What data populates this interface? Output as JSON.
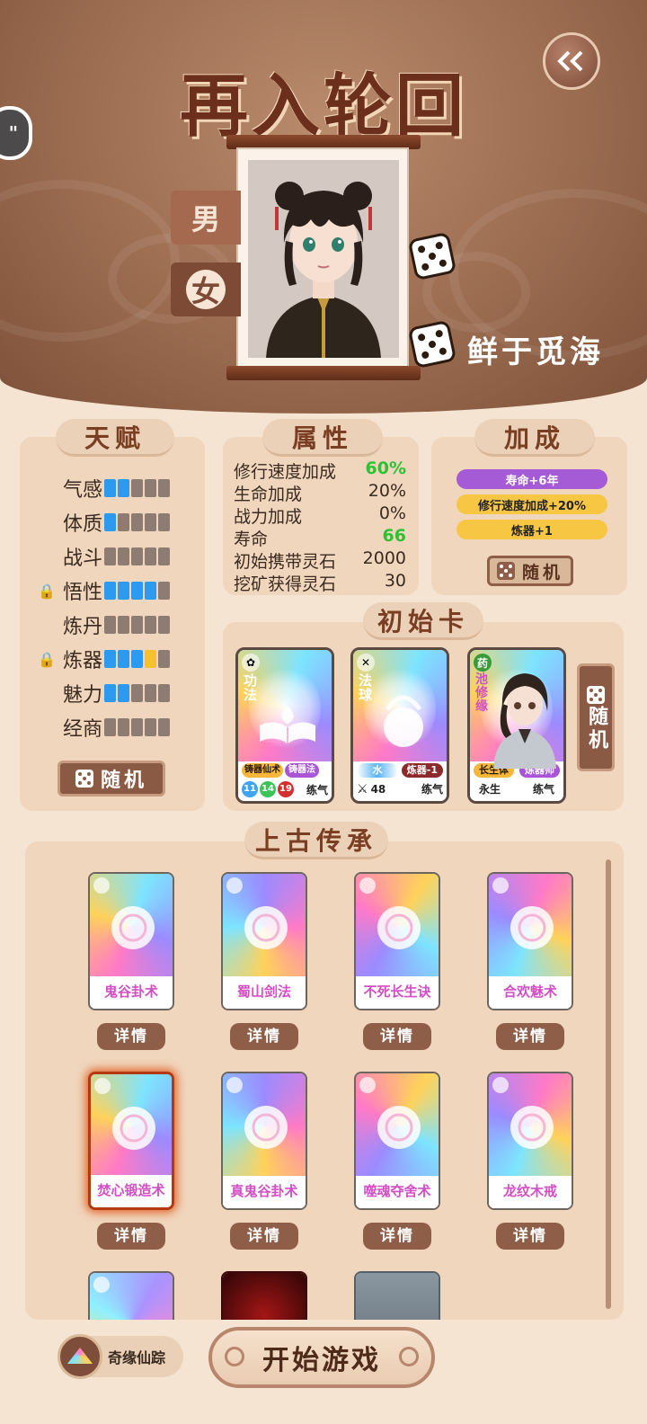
{
  "header": {
    "title": "再入轮回",
    "back_icon": "double-chevron-left-icon",
    "side_tab": "\"",
    "genders": {
      "male": "男",
      "female": "女"
    },
    "player_name": "鲜于觅海"
  },
  "talent": {
    "title": "天赋",
    "rows": [
      {
        "name": "气感",
        "locked": false,
        "blue": 2,
        "yellow": 0
      },
      {
        "name": "体质",
        "locked": false,
        "blue": 1,
        "yellow": 0
      },
      {
        "name": "战斗",
        "locked": false,
        "blue": 0,
        "yellow": 0
      },
      {
        "name": "悟性",
        "locked": true,
        "blue": 4,
        "yellow": 0
      },
      {
        "name": "炼丹",
        "locked": false,
        "blue": 0,
        "yellow": 0
      },
      {
        "name": "炼器",
        "locked": true,
        "blue": 3,
        "yellow": 1
      },
      {
        "name": "魅力",
        "locked": false,
        "blue": 2,
        "yellow": 0
      },
      {
        "name": "经商",
        "locked": false,
        "blue": 0,
        "yellow": 0
      }
    ],
    "random_label": "随机"
  },
  "attributes": {
    "title": "属性",
    "rows": [
      {
        "name": "修行速度加成",
        "value": "60%",
        "green": true
      },
      {
        "name": "生命加成",
        "value": "20%",
        "green": false
      },
      {
        "name": "战力加成",
        "value": "0%",
        "green": false
      },
      {
        "name": "寿命",
        "value": "66",
        "green": true
      },
      {
        "name": "初始携带灵石",
        "value": "2000",
        "green": false
      },
      {
        "name": "挖矿获得灵石",
        "value": "30",
        "green": false
      }
    ]
  },
  "bonus": {
    "title": "加成",
    "items": [
      {
        "text": "寿命+6年",
        "color": "#a55ad6"
      },
      {
        "text": "修行速度加成+20%",
        "color": "#f7c744"
      },
      {
        "text": "炼器+1",
        "color": "#f7c744"
      }
    ],
    "random_label": "随机"
  },
  "initial_cards": {
    "title": "初始卡",
    "random_label": "随机",
    "cards": [
      {
        "category": "功法",
        "tags": [
          "铸器仙术",
          "铸器法"
        ],
        "nums": [
          "11",
          "14",
          "19"
        ],
        "realm": "练气"
      },
      {
        "category": "法球",
        "tags": [
          "水",
          "炼器-1"
        ],
        "power": "48",
        "realm": "练气"
      },
      {
        "name": "池修缘",
        "badge": "药",
        "tags": [
          "长生体",
          "炼器师"
        ],
        "sub": "永生",
        "realm": "练气"
      }
    ]
  },
  "legacy": {
    "title": "上古传承",
    "detail_label": "详情",
    "items": [
      {
        "name": "鬼谷卦术"
      },
      {
        "name": "蜀山剑法"
      },
      {
        "name": "不死长生诀"
      },
      {
        "name": "合欢魅术"
      },
      {
        "name": "焚心锻造术",
        "selected": true
      },
      {
        "name": "真鬼谷卦术"
      },
      {
        "name": "噬魂夺舍术"
      },
      {
        "name": "龙纹木戒"
      }
    ]
  },
  "footer": {
    "qiyuan_label": "奇缘仙踪",
    "start_label": "开始游戏"
  },
  "colors": {
    "accent": "#8e5e48",
    "title": "#6b2f1c",
    "blue_pip": "#2b9af0",
    "green_value": "#2cc233"
  }
}
